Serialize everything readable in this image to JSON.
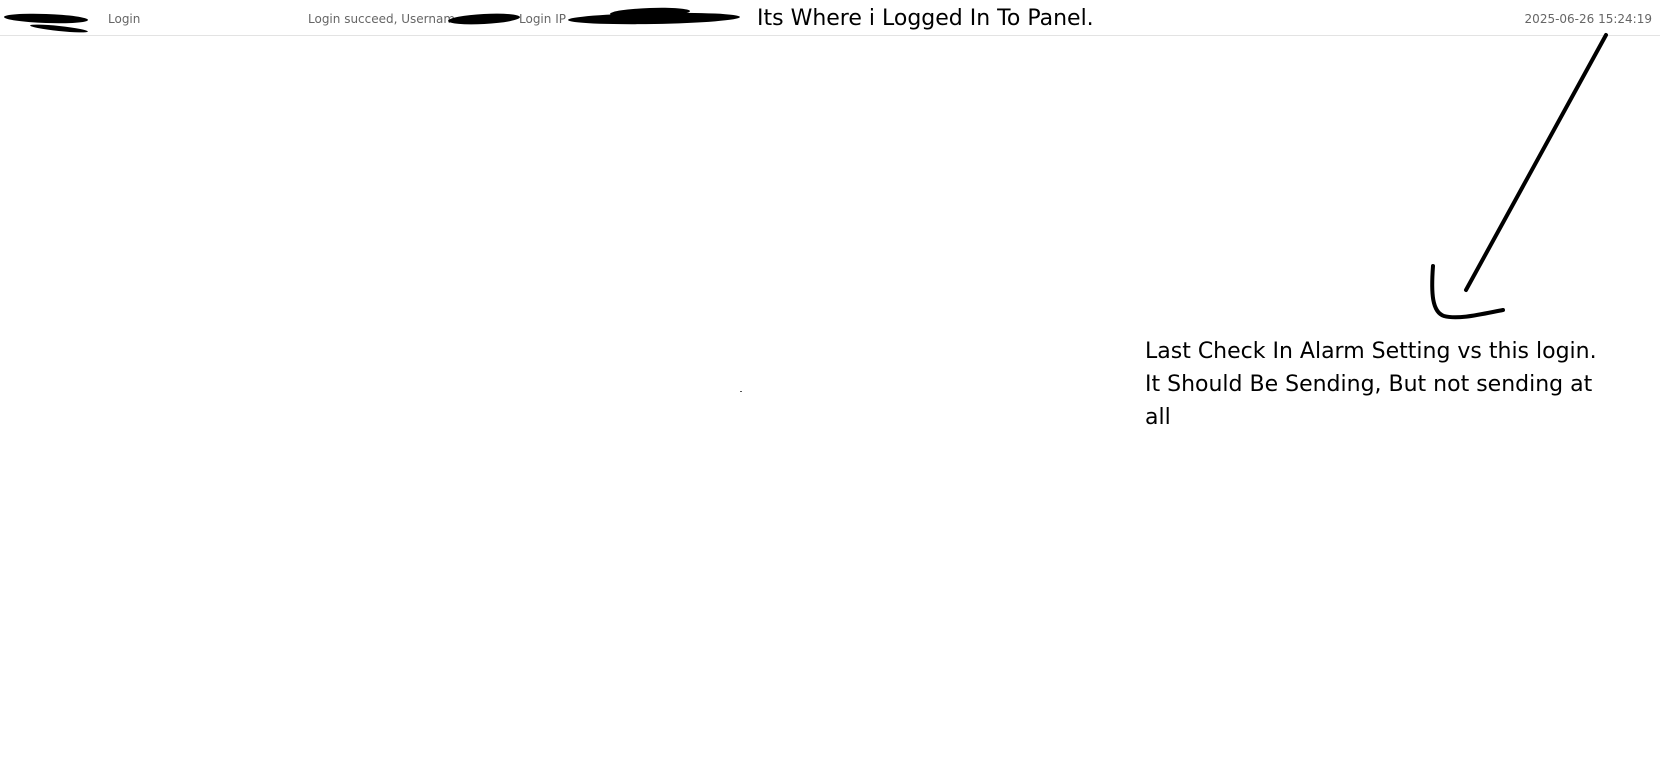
{
  "log_row": {
    "type": "Login",
    "description_prefix": "Login succeed, Usernam",
    "ip_label": "Login IP",
    "time": "2025-06-26 15:24:19"
  },
  "annotations": {
    "top_note": "Its Where i Logged In To Panel.",
    "side_note": "Last Check In Alarm Setting vs this login.\nIt Should Be Sending, But not sending at\nall"
  }
}
